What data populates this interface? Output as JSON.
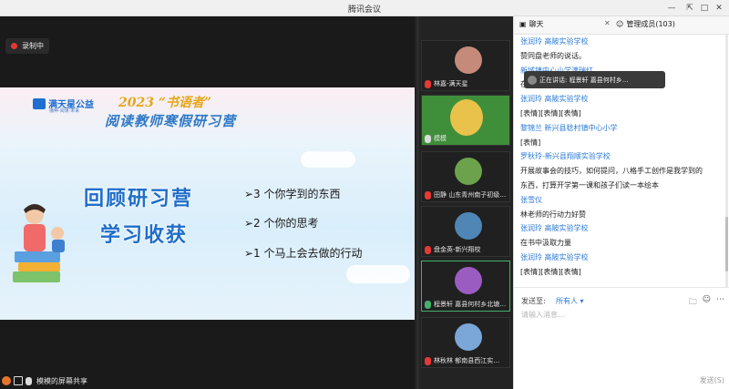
{
  "window": {
    "title": "腾讯会议",
    "controls": [
      "minimize-icon",
      "pin-icon",
      "maximize-icon",
      "close-icon"
    ]
  },
  "recording": {
    "label": "录制中",
    "color": "#e53935"
  },
  "slide": {
    "brand": "满天星公益",
    "brand_sub": "播种·阅读·未来",
    "title_line1": "2023 “书语者”",
    "title_line2": "阅读教师寒假研习营",
    "heading1": "回顾研习营",
    "heading2": "学习收获",
    "points": [
      "➢3 个你学到的东西",
      "➢2 个你的思考",
      "➢1 个马上会去做的行动"
    ]
  },
  "share_bar": {
    "label": "模模的屏幕共享"
  },
  "participants": [
    {
      "name": "林嘉-满天星",
      "mic": "muted",
      "pic_color": "#c58a7a"
    },
    {
      "name": "模模",
      "mic": "on",
      "pic_color": "#e8c24a"
    },
    {
      "name": "田静 山东青州南子初级…",
      "mic": "muted",
      "pic_color": "#6ca24c"
    },
    {
      "name": "盘金英-新兴翔校",
      "mic": "muted",
      "pic_color": "#4f86b5"
    },
    {
      "name": "程景轩  嘉县何村乡北塘…",
      "mic": "speaking",
      "pic_color": "#9b5cc2",
      "active": true
    },
    {
      "name": "林秋林  郁南县西江实…",
      "mic": "muted",
      "pic_color": "#7aa6d8"
    }
  ],
  "chat": {
    "tab_chat": "聊天",
    "tab_members": "管理成员(103)",
    "speaking_banner": "正在讲话: 程景轩  嘉县何村乡...",
    "messages": [
      {
        "type": "sender",
        "text": "张润玲  高陂实验学校"
      },
      {
        "type": "text",
        "text": "赞同盘老师的说话。"
      },
      {
        "type": "sender",
        "text": "新城镇中心小学满瑞红"
      },
      {
        "type": "text",
        "text": "在                                          受阅读的快乐。"
      },
      {
        "type": "sender",
        "text": "张润玲  高陂实验学校"
      },
      {
        "type": "text",
        "text": "[表情][表情][表情]"
      },
      {
        "type": "sender",
        "text": "黎锦兰 新兴县稔村镇中心小学"
      },
      {
        "type": "text",
        "text": "[表情]"
      },
      {
        "type": "sender",
        "text": "罗秋玲-新兴县翔顺实验学校"
      },
      {
        "type": "text",
        "text": "开展故事会的技巧，如何提问，八格手工创作是我学到的"
      },
      {
        "type": "text",
        "text": "东西，打算开学第一课和孩子们读一本绘本"
      },
      {
        "type": "sender",
        "text": "张雪仪"
      },
      {
        "type": "text",
        "text": "林老师的行动力好赞"
      },
      {
        "type": "sender",
        "text": "张润玲  高陂实验学校"
      },
      {
        "type": "text",
        "text": "在书中汲取力量"
      },
      {
        "type": "sender",
        "text": "张润玲  高陂实验学校"
      },
      {
        "type": "text",
        "text": "[表情][表情][表情]"
      }
    ],
    "send_to_label": "发送至:",
    "send_to_value": "所有人",
    "input_placeholder": "请输入消息...",
    "send_button": "发送(S)"
  }
}
